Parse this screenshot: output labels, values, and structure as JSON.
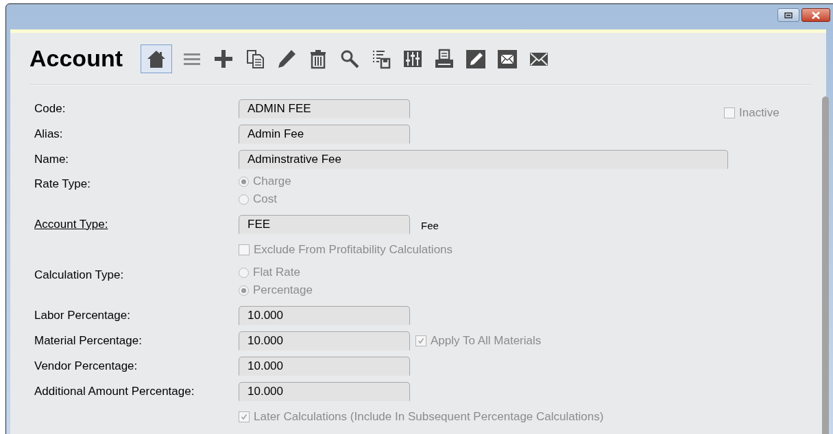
{
  "title": "Account",
  "toolbar": [
    {
      "kind": "home",
      "selected": true
    },
    {
      "kind": "list",
      "selected": false
    },
    {
      "kind": "plus",
      "selected": false
    },
    {
      "kind": "copy",
      "selected": false
    },
    {
      "kind": "pencil",
      "selected": false
    },
    {
      "kind": "trash",
      "selected": false
    },
    {
      "kind": "search",
      "selected": false
    },
    {
      "kind": "list_save",
      "selected": false
    },
    {
      "kind": "sliders",
      "selected": false
    },
    {
      "kind": "printer",
      "selected": false
    },
    {
      "kind": "pencil_box",
      "selected": false
    },
    {
      "kind": "mail_box",
      "selected": false
    },
    {
      "kind": "mail",
      "selected": false
    }
  ],
  "inactive": {
    "label": "Inactive",
    "checked": false,
    "disabled": true
  },
  "rows": [
    {
      "kind": "text",
      "label": "Code:",
      "value": "ADMIN FEE"
    },
    {
      "kind": "text",
      "label": "Alias:",
      "value": "Admin Fee"
    },
    {
      "kind": "wide_text",
      "label": "Name:",
      "value": "Adminstrative Fee"
    },
    {
      "kind": "radio",
      "label": "Rate Type:",
      "options": [
        {
          "label": "Charge",
          "selected": true,
          "disabled": true
        },
        {
          "label": "Cost",
          "selected": false,
          "disabled": true
        }
      ]
    },
    {
      "kind": "text",
      "label": "Account Type:",
      "link": true,
      "value": "FEE",
      "note": "Fee"
    },
    {
      "kind": "checkbox",
      "text": "Exclude From Profitability Calculations",
      "checked": false,
      "disabled": true
    },
    {
      "kind": "radio",
      "label": "Calculation Type:",
      "options": [
        {
          "label": "Flat Rate",
          "selected": false,
          "disabled": true
        },
        {
          "label": "Percentage",
          "selected": true,
          "disabled": true
        }
      ]
    },
    {
      "kind": "text",
      "label": "Labor Percentage:",
      "value": "10.000"
    },
    {
      "kind": "text",
      "label": "Material Percentage:",
      "value": "10.000",
      "option": {
        "label": "Apply To All Materials",
        "checked": true,
        "disabled": true
      }
    },
    {
      "kind": "text",
      "label": "Vendor Percentage:",
      "value": "10.000"
    },
    {
      "kind": "text",
      "label": "Additional Amount Percentage:",
      "value": "10.000"
    },
    {
      "kind": "checkbox",
      "text": "Later Calculations (Include In Subsequent Percentage Calculations)",
      "checked": true,
      "disabled": true
    }
  ]
}
